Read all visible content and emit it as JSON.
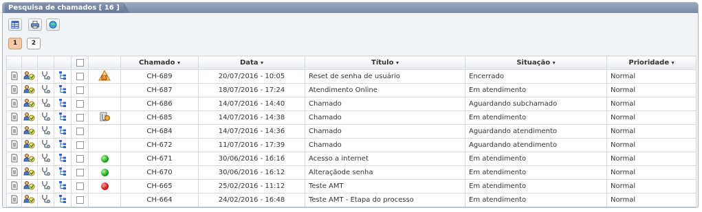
{
  "panel": {
    "title": "Pesquisa de chamados [ 16 ]"
  },
  "toolbar": {
    "buttons": [
      "grid-view-icon",
      "print-icon",
      "refresh-icon"
    ]
  },
  "pager": {
    "pages": [
      "1",
      "2"
    ],
    "active": "1"
  },
  "table": {
    "headers": {
      "chamado": "Chamado",
      "data": "Data",
      "titulo": "Título",
      "situacao": "Situação",
      "prioridade": "Prioridade"
    },
    "sort_arrow": "▾",
    "rows": [
      {
        "status_icon": "warning-icon",
        "chamado": "CH-689",
        "data": "20/07/2016 - 10:05",
        "titulo": "Reset de senha de usuário",
        "situacao": "Encerrado",
        "prioridade": "Normal"
      },
      {
        "status_icon": "",
        "chamado": "CH-687",
        "data": "18/07/2016 - 17:24",
        "titulo": "Atendimento Online",
        "situacao": "Em atendimento",
        "prioridade": "Normal"
      },
      {
        "status_icon": "",
        "chamado": "CH-686",
        "data": "14/07/2016 - 14:40",
        "titulo": "Chamado",
        "situacao": "Aguardando subchamado",
        "prioridade": "Normal"
      },
      {
        "status_icon": "attachment-info-icon",
        "chamado": "CH-685",
        "data": "14/07/2016 - 14:38",
        "titulo": "Chamado",
        "situacao": "Em atendimento",
        "prioridade": "Normal"
      },
      {
        "status_icon": "",
        "chamado": "CH-684",
        "data": "14/07/2016 - 14:36",
        "titulo": "Chamado",
        "situacao": "Aguardando atendimento",
        "prioridade": "Normal"
      },
      {
        "status_icon": "",
        "chamado": "CH-672",
        "data": "11/07/2016 - 17:39",
        "titulo": "Chamado",
        "situacao": "Aguardando atendimento",
        "prioridade": "Normal"
      },
      {
        "status_icon": "green-dot-icon",
        "chamado": "CH-671",
        "data": "30/06/2016 - 16:16",
        "titulo": "Acesso a internet",
        "situacao": "Em atendimento",
        "prioridade": "Normal"
      },
      {
        "status_icon": "green-dot-icon",
        "chamado": "CH-670",
        "data": "30/06/2016 - 16:12",
        "titulo": "Alteraçãode senha",
        "situacao": "Em atendimento",
        "prioridade": "Normal"
      },
      {
        "status_icon": "red-dot-icon",
        "chamado": "CH-665",
        "data": "25/02/2016 - 11:12",
        "titulo": "Teste AMT",
        "situacao": "Em atendimento",
        "prioridade": "Normal"
      },
      {
        "status_icon": "",
        "chamado": "CH-664",
        "data": "24/02/2016 - 16:48",
        "titulo": "Teste AMT - Etapa do processo",
        "situacao": "Em atendimento",
        "prioridade": "Normal"
      }
    ]
  },
  "colors": {
    "titlebar": "#7b8ba6",
    "active_page": "#f6c9a4",
    "status_green": "#18a316",
    "status_red": "#d11414"
  }
}
